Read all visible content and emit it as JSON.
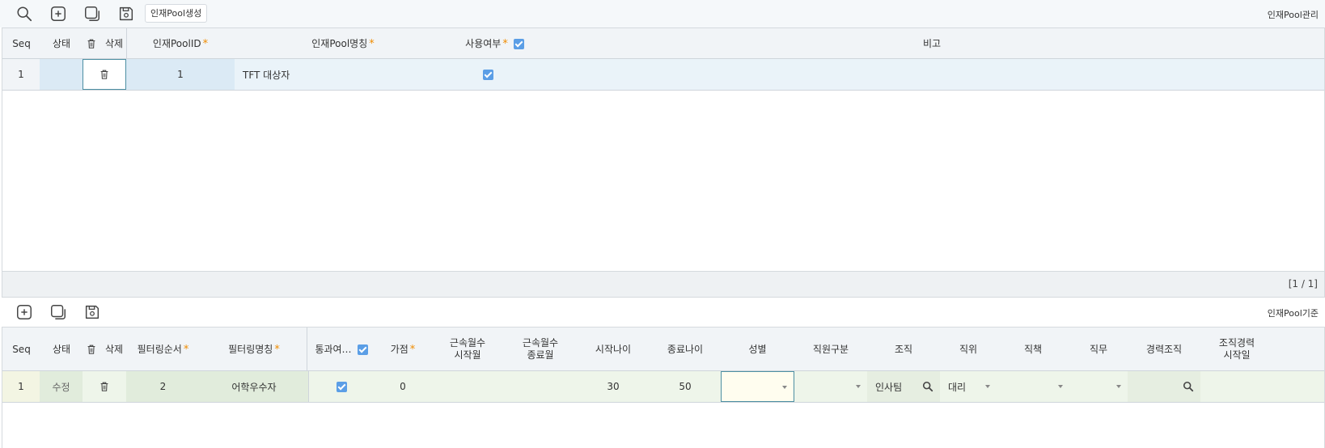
{
  "top_toolbar": {
    "create_pool_label": "인재Pool생성",
    "screen_title": "인재Pool관리"
  },
  "pool_grid": {
    "headers": {
      "seq": "Seq",
      "status": "상태",
      "delete": "삭제",
      "pool_id": "인재PoolID",
      "pool_name": "인재Pool명칭",
      "use_yn": "사용여부",
      "remark": "비고"
    },
    "rows": [
      {
        "seq": "1",
        "status": "",
        "pool_id": "1",
        "pool_name": "TFT 대상자",
        "use_yn": true,
        "remark": ""
      }
    ],
    "pager": "[1 / 1]"
  },
  "bottom_toolbar": {
    "screen_title": "인재Pool기준"
  },
  "criteria_grid": {
    "headers": {
      "seq": "Seq",
      "status": "상태",
      "delete": "삭제",
      "filter_order": "필터링순서",
      "filter_name": "필터링명칭",
      "pass_yn": "통과여…",
      "score": "가점",
      "tenure_start_1": "근속월수",
      "tenure_start_2": "시작월",
      "tenure_end_1": "근속월수",
      "tenure_end_2": "종료월",
      "start_age": "시작나이",
      "end_age": "종료나이",
      "gender": "성별",
      "emp_type": "직원구분",
      "org": "조직",
      "position": "직위",
      "duty": "직책",
      "job": "직무",
      "career_org": "경력조직",
      "org_career_start_1": "조직경력",
      "org_career_start_2": "시작일"
    },
    "rows": [
      {
        "seq": "1",
        "status": "수정",
        "filter_order": "2",
        "filter_name": "어학우수자",
        "pass_yn": true,
        "score": "0",
        "tenure_start": "",
        "tenure_end": "",
        "start_age": "30",
        "end_age": "50",
        "gender": "",
        "emp_type": "",
        "org": "인사팀",
        "position": "대리",
        "duty": "",
        "job": "",
        "career_org": ""
      }
    ]
  },
  "colors": {
    "accent_check": "#5b9ee6",
    "required_star": "#f08c00",
    "row_selected_top": "#eaf3f9",
    "row_selected_bottom": "#eef5ea"
  }
}
